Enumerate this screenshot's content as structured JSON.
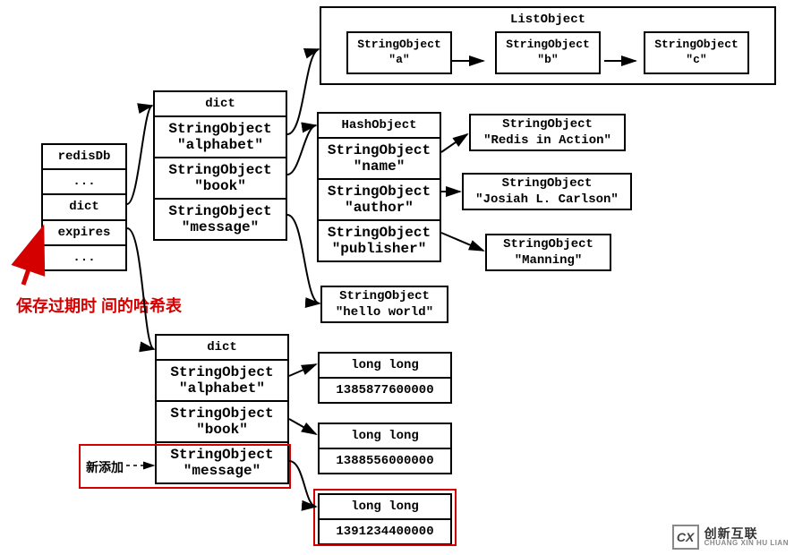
{
  "redisDb": {
    "title": "redisDb",
    "rows": [
      "...",
      "dict",
      "expires",
      "..."
    ]
  },
  "dict1": {
    "title": "dict",
    "items": [
      {
        "type": "StringObject",
        "val": "\"alphabet\""
      },
      {
        "type": "StringObject",
        "val": "\"book\""
      },
      {
        "type": "StringObject",
        "val": "\"message\""
      }
    ]
  },
  "dict2": {
    "title": "dict",
    "items": [
      {
        "type": "StringObject",
        "val": "\"alphabet\""
      },
      {
        "type": "StringObject",
        "val": "\"book\""
      },
      {
        "type": "StringObject",
        "val": "\"message\""
      }
    ]
  },
  "listObject": {
    "title": "ListObject",
    "items": [
      {
        "type": "StringObject",
        "val": "\"a\""
      },
      {
        "type": "StringObject",
        "val": "\"b\""
      },
      {
        "type": "StringObject",
        "val": "\"c\""
      }
    ]
  },
  "hashObject": {
    "title": "HashObject",
    "fields": [
      {
        "type": "StringObject",
        "val": "\"name\""
      },
      {
        "type": "StringObject",
        "val": "\"author\""
      },
      {
        "type": "StringObject",
        "val": "\"publisher\""
      }
    ],
    "values": [
      {
        "type": "StringObject",
        "val": "\"Redis in Action\""
      },
      {
        "type": "StringObject",
        "val": "\"Josiah L. Carlson\""
      },
      {
        "type": "StringObject",
        "val": "\"Manning\""
      }
    ]
  },
  "helloWorld": {
    "type": "StringObject",
    "val": "\"hello world\""
  },
  "longs": [
    {
      "type": "long long",
      "val": "1385877600000"
    },
    {
      "type": "long long",
      "val": "1388556000000"
    },
    {
      "type": "long long",
      "val": "1391234400000"
    }
  ],
  "annot": {
    "expiresHash": "保存过期时\n间的哈希表",
    "newAdded": "新添加"
  },
  "logo": {
    "mark": "CX",
    "cn": "创新互联",
    "py": "CHUANG XIN HU LIAN"
  }
}
